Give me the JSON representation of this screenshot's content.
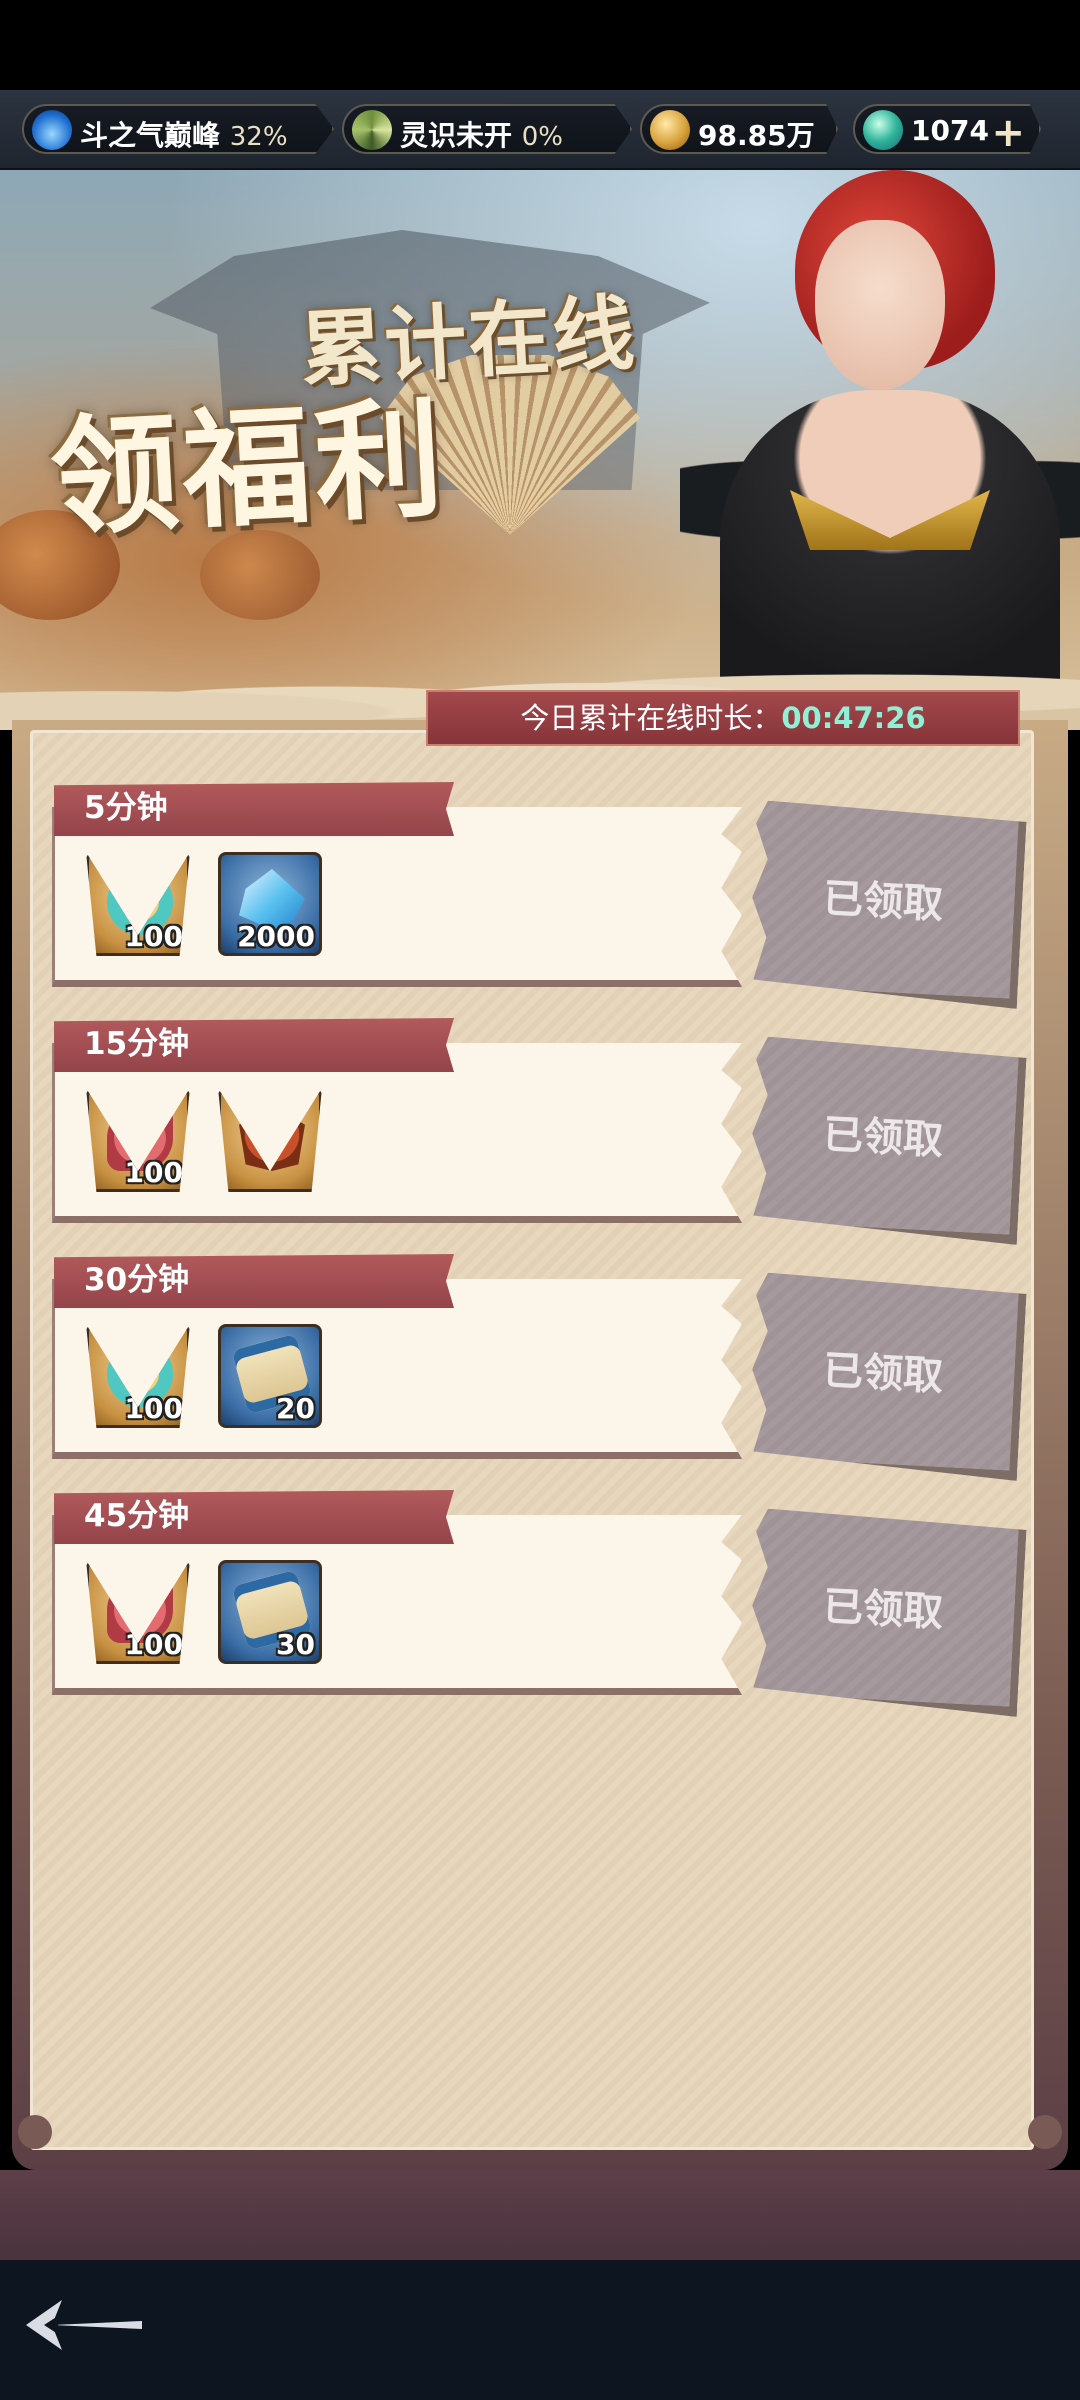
{
  "resources": [
    {
      "label": "斗之气巅峰",
      "value": "32%",
      "icon": "flame-icon"
    },
    {
      "label": "灵识未开",
      "value": "0%",
      "icon": "swirl-icon"
    },
    {
      "label": "98.85万",
      "value": "",
      "icon": "gold-coin-icon"
    },
    {
      "label": "1074",
      "value": "",
      "icon": "jade-coin-icon"
    }
  ],
  "add_symbol": "+",
  "banner": {
    "subtitle": "累计在线",
    "title": "领福利"
  },
  "timer": {
    "label": "今日累计在线时长：",
    "value": "00:47:26"
  },
  "rewards": [
    {
      "time": "5分钟",
      "items": [
        {
          "icon": "ring-icon",
          "qty": "100"
        },
        {
          "icon": "crystal-icon",
          "qty": "2000"
        }
      ],
      "status": "已领取"
    },
    {
      "time": "15分钟",
      "items": [
        {
          "icon": "flower-icon",
          "qty": "100"
        },
        {
          "icon": "seal-icon",
          "qty": ""
        }
      ],
      "status": "已领取"
    },
    {
      "time": "30分钟",
      "items": [
        {
          "icon": "ring-icon",
          "qty": "100"
        },
        {
          "icon": "scroll-icon",
          "qty": "20"
        }
      ],
      "status": "已领取"
    },
    {
      "time": "45分钟",
      "items": [
        {
          "icon": "flower-icon",
          "qty": "100"
        },
        {
          "icon": "scroll-icon",
          "qty": "30"
        }
      ],
      "status": "已领取"
    }
  ],
  "colors": {
    "accent": "#94444a",
    "timer_value": "#8ff0d6",
    "claimed": "#a5999d"
  }
}
